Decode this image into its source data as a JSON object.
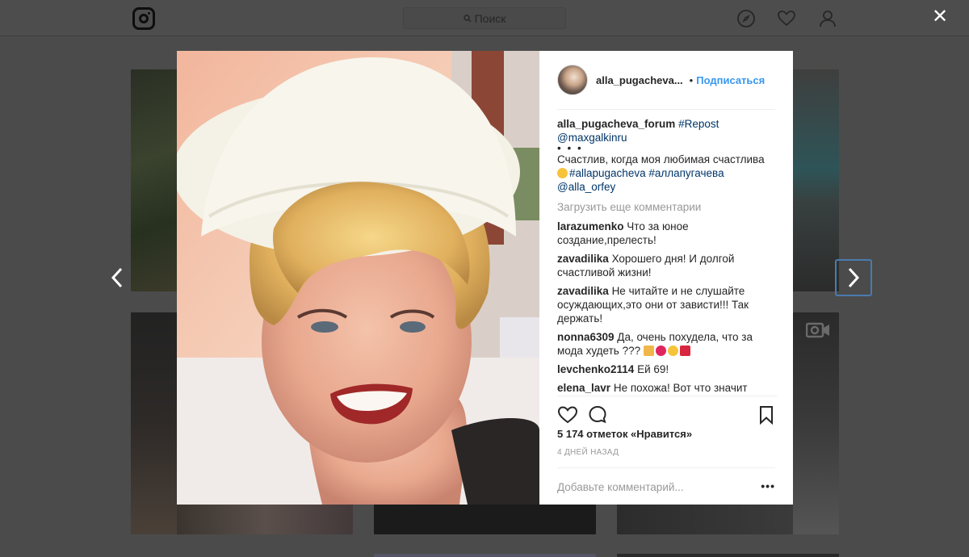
{
  "topbar": {
    "search_placeholder": "Поиск",
    "icons": [
      "instagram-logo",
      "search-icon",
      "compass-icon",
      "heart-icon",
      "profile-icon"
    ],
    "close_label": "✕"
  },
  "post": {
    "username": "alla_pugacheva...",
    "separator": "•",
    "follow_label": "Подписаться",
    "caption": {
      "user": "alla_pugacheva_forum",
      "tag_repost": "#Repost",
      "mention": "@maxgalkinru",
      "dots": "• • •",
      "text": "Счастлив, когда моя любимая счастлива",
      "tags": "#allapugacheva #аллапугачева",
      "mention2": "@alla_orfey"
    },
    "load_more": "Загрузить еще комментарии",
    "comments": [
      {
        "user": "larazumenko",
        "text": "Что за юное создание,прелесть!"
      },
      {
        "user": "zavadilika",
        "text": "Хорошего дня! И долгой счастливой жизни!"
      },
      {
        "user": "zavadilika",
        "text": "Не читайте и не слушайте осуждающих,это они от зависти!!! Так держать!"
      },
      {
        "user": "nonna6309",
        "text": "Да, очень похудела, что за мода худеть ???"
      },
      {
        "user": "levchenko2114",
        "text": "Ей 69!"
      },
      {
        "user": "elena_lavr",
        "text": "Не похожа! Вот что значит"
      }
    ],
    "likes": "5 174 отметок «Нравится»",
    "time": "4 ДНЕЙ НАЗАД",
    "add_comment_placeholder": "Добавьте комментарий...",
    "more_label": "•••"
  },
  "colors": {
    "overlay": "#4b4b4b",
    "link": "#003569",
    "follow": "#3897f0",
    "muted": "#999999"
  }
}
